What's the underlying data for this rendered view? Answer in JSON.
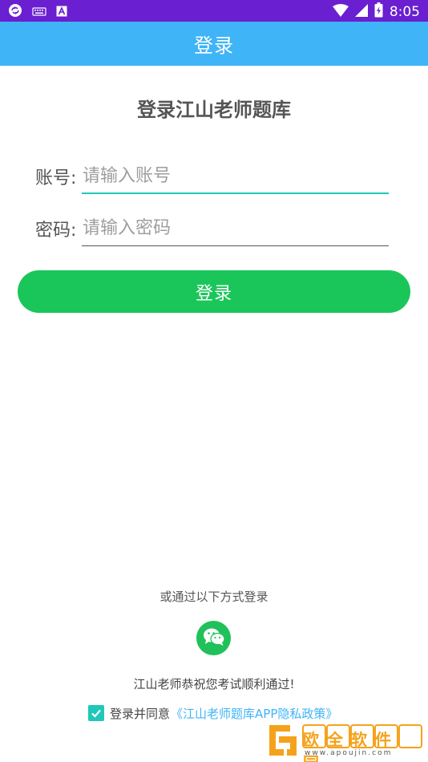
{
  "status_bar": {
    "time": "8:05",
    "icons": [
      "sync-icon",
      "keyboard-icon",
      "font-a-icon",
      "wifi-icon",
      "signal-icon",
      "battery-icon"
    ]
  },
  "app_bar": {
    "title": "登录"
  },
  "headline": "登录江山老师题库",
  "form": {
    "account_label": "账号:",
    "account_placeholder": "请输入账号",
    "password_label": "密码:",
    "password_placeholder": "请输入密码"
  },
  "login_button": "登录",
  "alt_login": {
    "label": "或通过以下方式登录",
    "icon": "wechat-icon"
  },
  "wish": "江山老师恭祝您考试顺利通过!",
  "agreement": {
    "checked": true,
    "text": "登录并同意",
    "policy_link": "《江山老师题库APP隐私政策》"
  },
  "watermark": {
    "title": "欧全软件园",
    "url": "www.apoujin.com"
  },
  "colors": {
    "status_bar": "#6a1fd0",
    "app_bar": "#3fb4f7",
    "button": "#1ac65a",
    "accent": "#1fc8b8",
    "link": "#3fb4f7"
  }
}
